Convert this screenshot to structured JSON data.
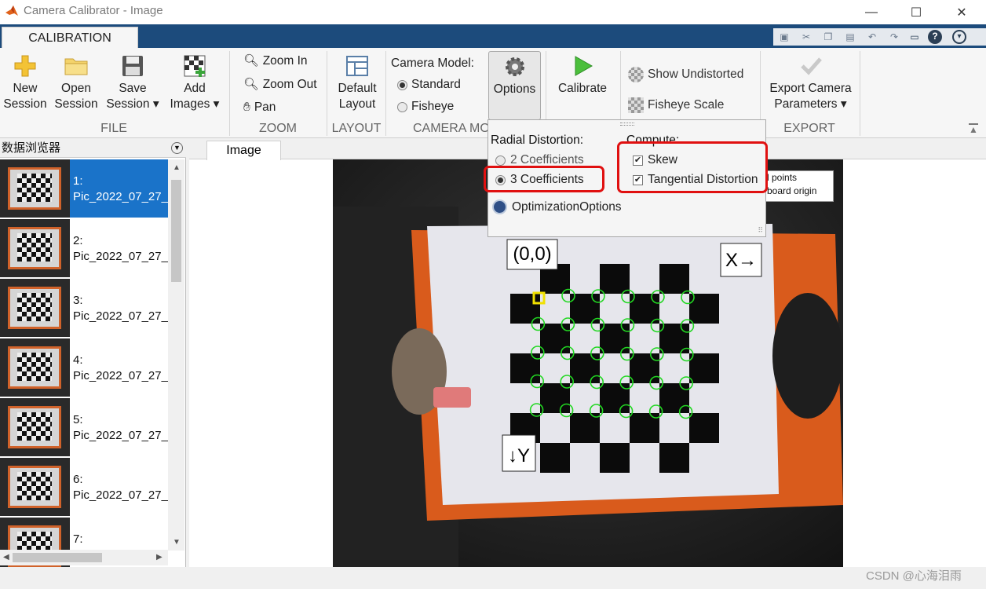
{
  "window": {
    "title": "Camera Calibrator - Image",
    "controls": {
      "minimize": "—",
      "maximize": "☐",
      "close": "✕"
    }
  },
  "tabs": {
    "active": "CALIBRATION"
  },
  "toolstrip": {
    "file": {
      "label": "FILE",
      "new_session": [
        "New",
        "Session"
      ],
      "open_session": [
        "Open",
        "Session"
      ],
      "save_session": [
        "Save",
        "Session"
      ],
      "add_images": [
        "Add",
        "Images"
      ]
    },
    "zoom": {
      "label": "ZOOM",
      "zoom_in": "Zoom In",
      "zoom_out": "Zoom Out",
      "pan": "Pan"
    },
    "layout": {
      "label": "LAYOUT",
      "default_layout": [
        "Default",
        "Layout"
      ]
    },
    "camera_model": {
      "label": "CAMERA MO",
      "title": "Camera Model:",
      "standard": "Standard",
      "fisheye": "Fisheye",
      "selected": "Standard"
    },
    "options": "Options",
    "calibrate": "Calibrate",
    "show_undistorted": "Show Undistorted",
    "fisheye_scale": "Fisheye Scale",
    "export": {
      "label": "EXPORT",
      "button": [
        "Export Camera",
        "Parameters"
      ]
    }
  },
  "options_panel": {
    "radial_label": "Radial Distortion:",
    "radial_options": [
      "2 Coefficients",
      "3 Coefficients"
    ],
    "radial_selected": "3 Coefficients",
    "compute_label": "Compute:",
    "skew": {
      "label": "Skew",
      "checked": true
    },
    "tangential": {
      "label": "Tangential Distortion",
      "checked": true
    },
    "optimization": "OptimizationOptions"
  },
  "browser": {
    "title": "数据浏览器",
    "items": [
      {
        "num": "1:",
        "name": "Pic_2022_07_27_"
      },
      {
        "num": "2:",
        "name": "Pic_2022_07_27_"
      },
      {
        "num": "3:",
        "name": "Pic_2022_07_27_"
      },
      {
        "num": "4:",
        "name": "Pic_2022_07_27_"
      },
      {
        "num": "5:",
        "name": "Pic_2022_07_27_"
      },
      {
        "num": "6:",
        "name": "Pic_2022_07_27_"
      },
      {
        "num": "7:",
        "name": ""
      }
    ],
    "selected_index": 0
  },
  "document": {
    "tab": "Image",
    "origin_label": "(0,0)",
    "x_label": "X→",
    "y_label": "↓Y",
    "legend": [
      "d points",
      "rboard origin"
    ]
  },
  "colors": {
    "accent": "#1c4b7c",
    "selection": "#1a73c9",
    "detected": "#22d822",
    "origin": "#f0e000",
    "highlight": "#e01010"
  },
  "watermark": "CSDN @心海泪雨"
}
